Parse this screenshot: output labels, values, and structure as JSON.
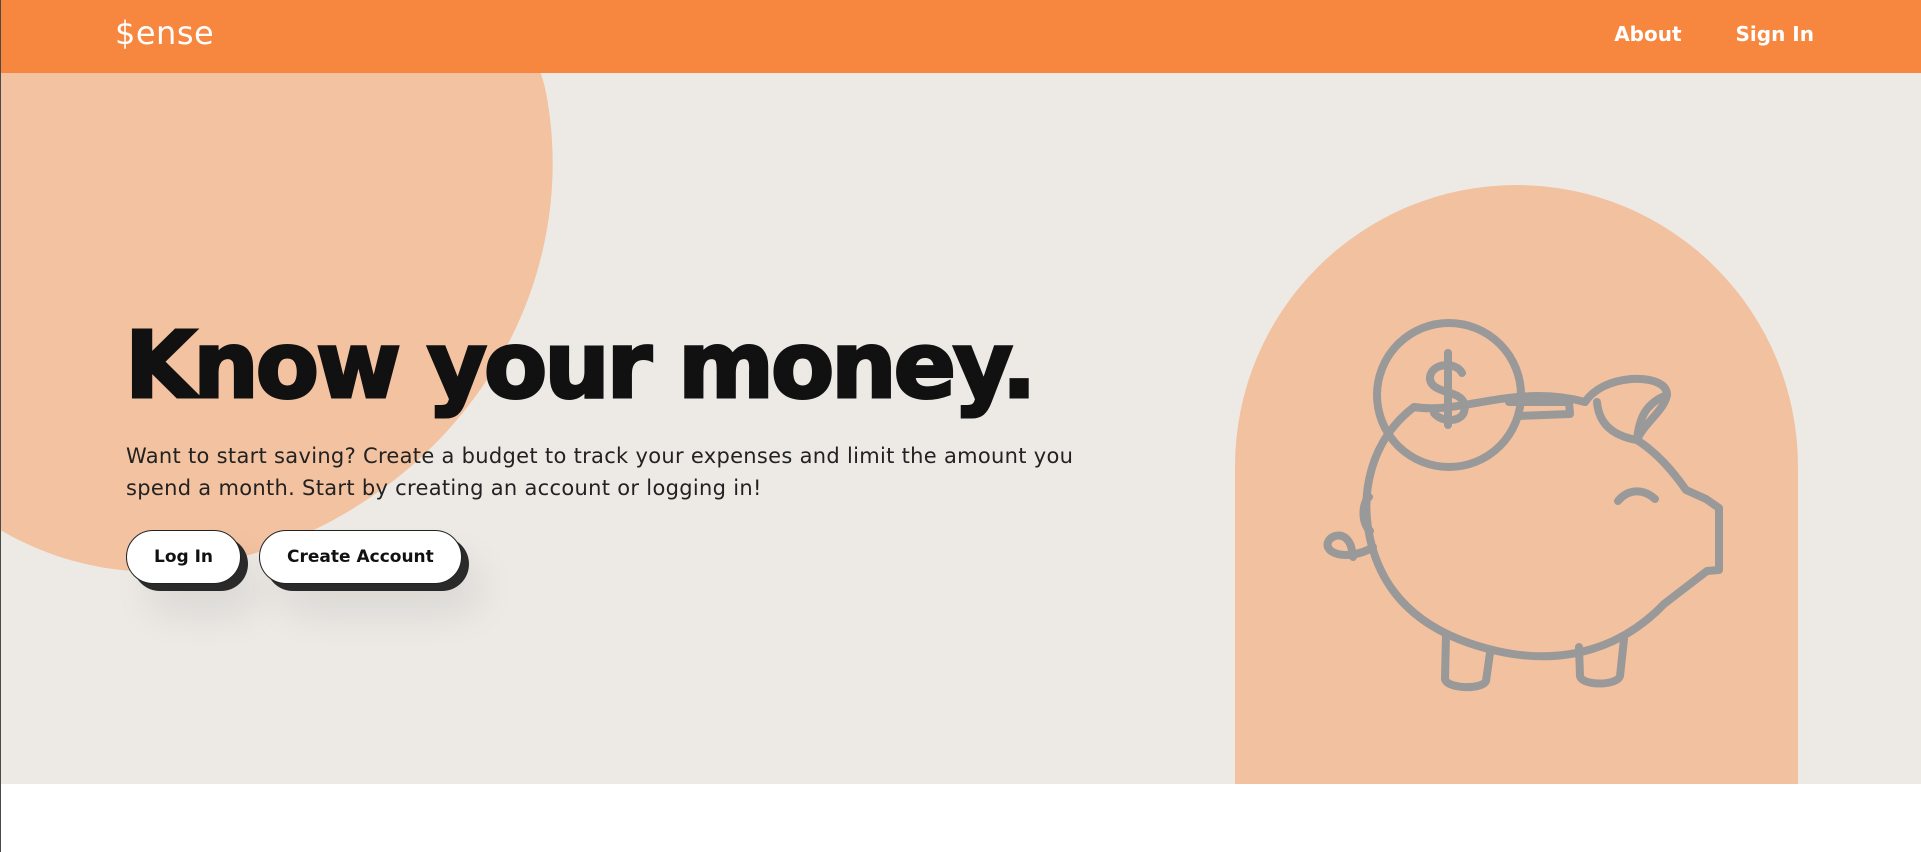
{
  "navbar": {
    "logo": "$ense",
    "links": [
      "About",
      "Sign In"
    ]
  },
  "hero": {
    "title": "Know your money.",
    "description": "Want to start saving? Create a budget to track your expenses and limit the amount you spend a month. Start by creating an account or logging in!",
    "buttons": [
      "Log In",
      "Create Account"
    ]
  },
  "illustration": {
    "icon": "piggy-bank-icon",
    "coin_symbol": "$"
  },
  "colors": {
    "primary": "#f7863e",
    "accent_soft": "#f2c1a0",
    "background": "#edeae6",
    "text": "#111111"
  }
}
